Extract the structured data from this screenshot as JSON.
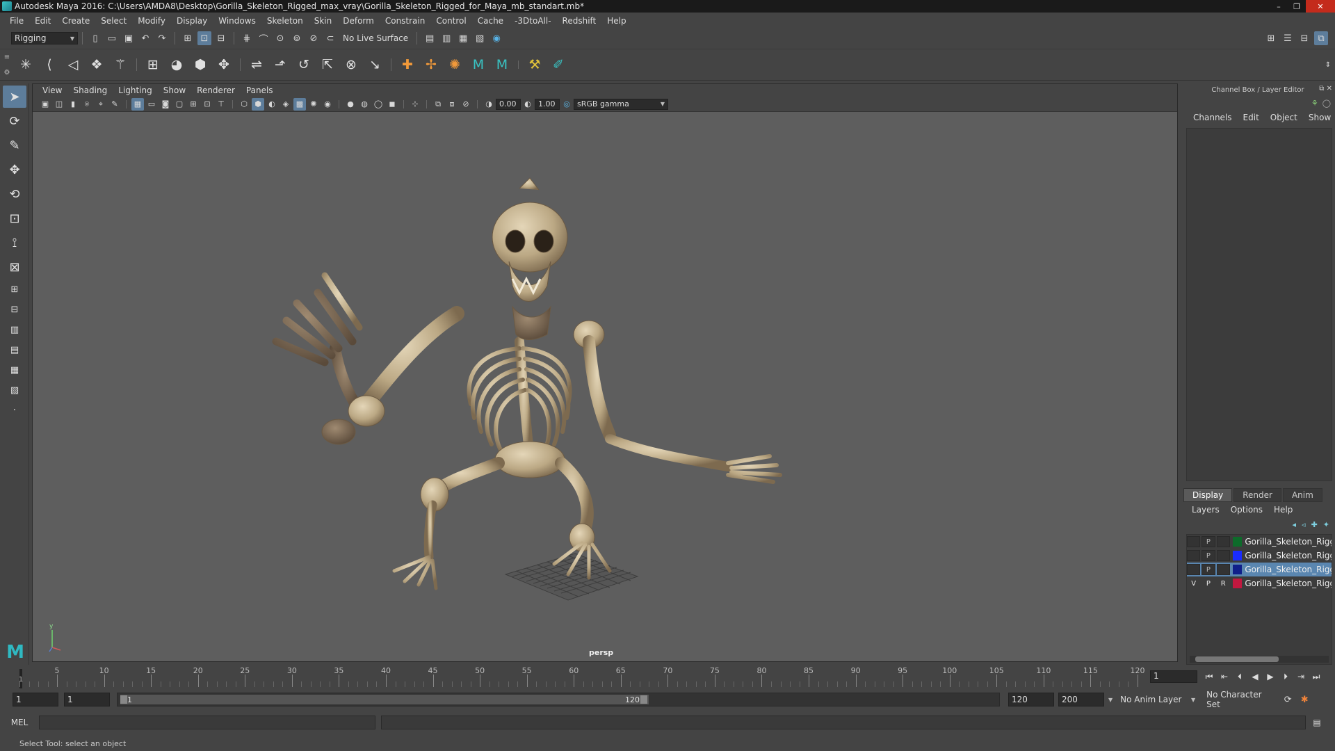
{
  "window": {
    "title": "Autodesk Maya 2016: C:\\Users\\AMDA8\\Desktop\\Gorilla_Skeleton_Rigged_max_vray\\Gorilla_Skeleton_Rigged_for_Maya_mb_standart.mb*",
    "minimize": "–",
    "maximize": "❐",
    "close": "✕"
  },
  "menubar": {
    "items": [
      "File",
      "Edit",
      "Create",
      "Select",
      "Modify",
      "Display",
      "Windows",
      "Skeleton",
      "Skin",
      "Deform",
      "Constrain",
      "Control",
      "Cache",
      "-3DtoAll-",
      "Redshift",
      "Help"
    ]
  },
  "statusline": {
    "menuset": "Rigging",
    "live_surface": "No Live Surface"
  },
  "viewport": {
    "panel_menu": [
      "View",
      "Shading",
      "Lighting",
      "Show",
      "Renderer",
      "Panels"
    ],
    "exposure": "0.00",
    "gamma": "1.00",
    "color_space": "sRGB gamma",
    "camera": "persp",
    "axis_y": "y"
  },
  "channel_box": {
    "title": "Channel Box / Layer Editor",
    "menus": [
      "Channels",
      "Edit",
      "Object",
      "Show"
    ],
    "layer_tabs": [
      "Display",
      "Render",
      "Anim"
    ],
    "layer_menus": [
      "Layers",
      "Options",
      "Help"
    ],
    "layers": [
      {
        "v": "",
        "p": "P",
        "r": "",
        "color": "#0d6b2a",
        "name": "Gorilla_Skeleton_Rigg"
      },
      {
        "v": "",
        "p": "P",
        "r": "",
        "color": "#1a2cff",
        "name": "Gorilla_Skeleton_Rigg"
      },
      {
        "v": "",
        "p": "P",
        "r": "",
        "color": "#101f8a",
        "name": "Gorilla_Skeleton_Rigg",
        "selected": true
      },
      {
        "v": "V",
        "p": "P",
        "r": "R",
        "color": "#c2183f",
        "name": "Gorilla_Skeleton_Rigg"
      }
    ]
  },
  "timeline": {
    "start": 1,
    "end": 120,
    "major_step": 5,
    "labels": [
      "5",
      "10",
      "15",
      "20",
      "25",
      "30",
      "35",
      "40",
      "45",
      "50",
      "55",
      "60",
      "65",
      "70",
      "75",
      "80",
      "85",
      "90",
      "95",
      "100",
      "105",
      "110",
      "115",
      "120"
    ],
    "current_marker": "1",
    "current_frame": "1"
  },
  "range": {
    "start_field": "1",
    "playback_start": "1",
    "range_start_label": "1",
    "range_end_label": "120",
    "playback_end": "120",
    "end_field": "200",
    "anim_layer": "No Anim Layer",
    "character_set": "No Character Set"
  },
  "cmdline": {
    "language": "MEL"
  },
  "helpline": {
    "text": "Select Tool: select an object"
  },
  "icons": {
    "select": "arrow-select-icon",
    "lasso": "lasso-icon",
    "paint": "paint-select-icon",
    "move": "move-icon",
    "rotate": "rotate-icon",
    "scale": "scale-icon"
  }
}
